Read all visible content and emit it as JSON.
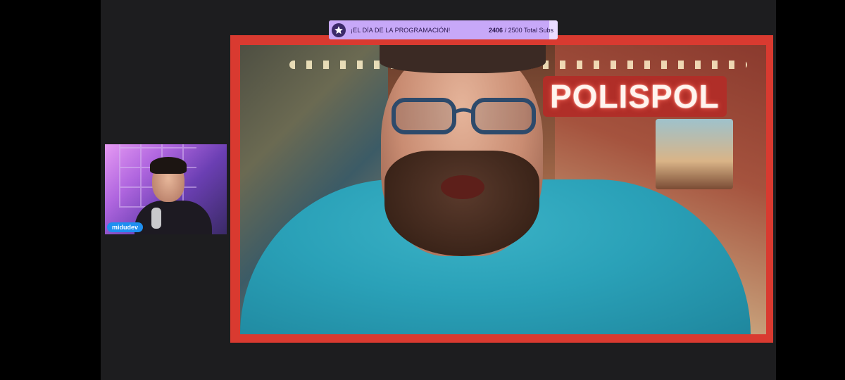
{
  "goal": {
    "title": "¡EL DÍA DE LA PROGRAMACIÓN!",
    "current": "2406",
    "separator": "/",
    "target_text": "2500 Total Subs",
    "progress": 0.9624,
    "icon": "star-icon",
    "colors": {
      "bar": "#c7a8f8",
      "remainder": "#eadcff"
    }
  },
  "main_video": {
    "sign_text": "POLISPOL",
    "frame_color": "#d93a30"
  },
  "webcam": {
    "name": "midudev",
    "tag_color": "#1f8ff0"
  }
}
